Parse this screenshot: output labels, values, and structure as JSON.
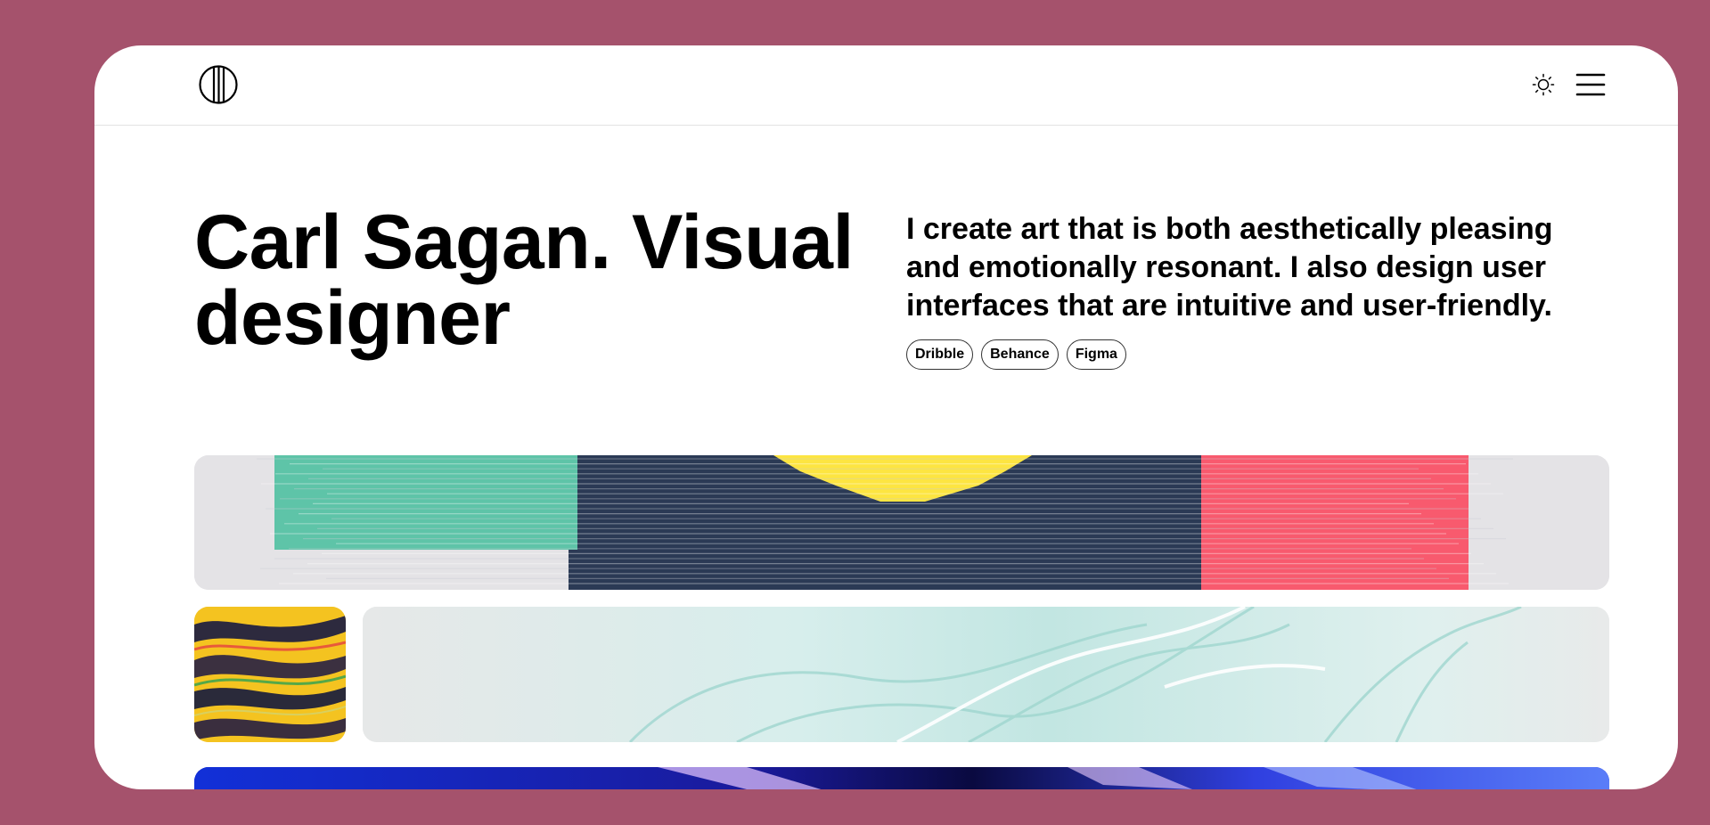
{
  "header": {
    "logo_icon": "circle-stripes-logo-icon",
    "theme_icon": "sun-icon",
    "menu_icon": "hamburger-menu-icon"
  },
  "hero": {
    "title": "Carl Sagan. Visual designer",
    "description": "I create art that is both aesthetically pleasing and emotionally resonant. I also design user interfaces that are intuitive and user-friendly.",
    "tags": [
      "Dribble",
      "Behance",
      "Figma"
    ]
  },
  "colors": {
    "page_background": "#a5526c",
    "card_background": "#ffffff",
    "text": "#000000",
    "art_teal": "#5ec4a8",
    "art_navy": "#2b3a55",
    "art_yellow": "#fde541",
    "art_red": "#f85a6e"
  }
}
